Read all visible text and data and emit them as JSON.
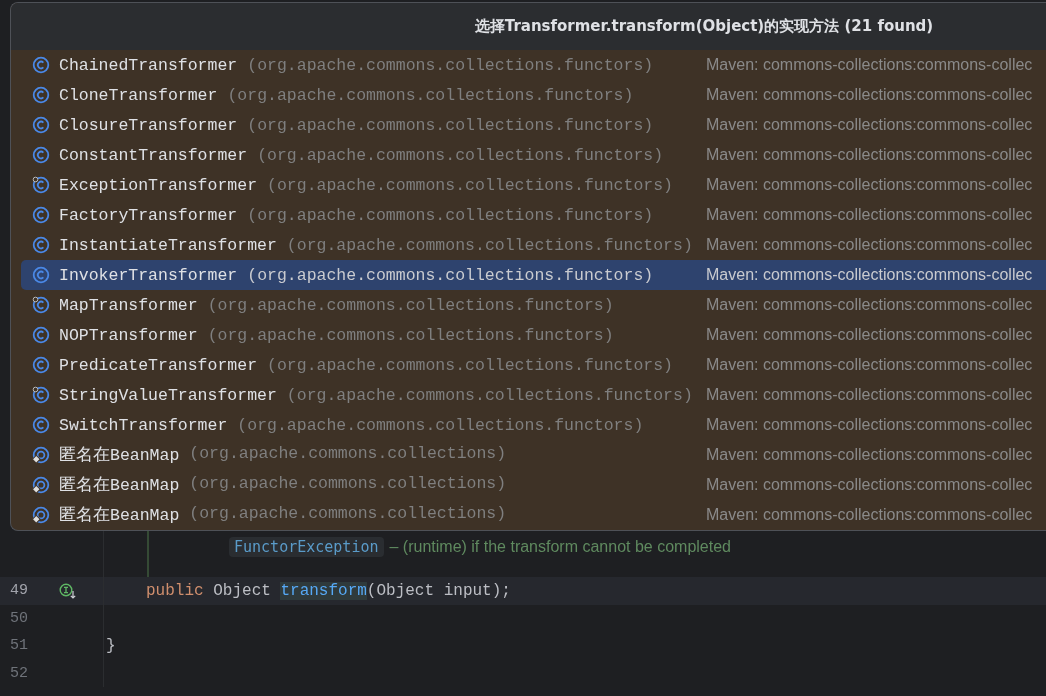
{
  "popup": {
    "title": "选择Transformer.transform(Object)的实现方法 (21 found)",
    "items": [
      {
        "kind": "class",
        "name": "ChainedTransformer",
        "package": "(org.apache.commons.collections.functors)",
        "source": "Maven: commons-collections:commons-collec",
        "selected": false
      },
      {
        "kind": "class",
        "name": "CloneTransformer",
        "package": "(org.apache.commons.collections.functors)",
        "source": "Maven: commons-collections:commons-collec",
        "selected": false
      },
      {
        "kind": "class",
        "name": "ClosureTransformer",
        "package": "(org.apache.commons.collections.functors)",
        "source": "Maven: commons-collections:commons-collec",
        "selected": false
      },
      {
        "kind": "class",
        "name": "ConstantTransformer",
        "package": "(org.apache.commons.collections.functors)",
        "source": "Maven: commons-collections:commons-collec",
        "selected": false
      },
      {
        "kind": "linked-class",
        "name": "ExceptionTransformer",
        "package": "(org.apache.commons.collections.functors)",
        "source": "Maven: commons-collections:commons-collec",
        "selected": false
      },
      {
        "kind": "class",
        "name": "FactoryTransformer",
        "package": "(org.apache.commons.collections.functors)",
        "source": "Maven: commons-collections:commons-collec",
        "selected": false
      },
      {
        "kind": "class",
        "name": "InstantiateTransformer",
        "package": "(org.apache.commons.collections.functors)",
        "source": "Maven: commons-collections:commons-collec",
        "selected": false
      },
      {
        "kind": "class",
        "name": "InvokerTransformer",
        "package": "(org.apache.commons.collections.functors)",
        "source": "Maven: commons-collections:commons-collec",
        "selected": true
      },
      {
        "kind": "linked-class",
        "name": "MapTransformer",
        "package": "(org.apache.commons.collections.functors)",
        "source": "Maven: commons-collections:commons-collec",
        "selected": false
      },
      {
        "kind": "class",
        "name": "NOPTransformer",
        "package": "(org.apache.commons.collections.functors)",
        "source": "Maven: commons-collections:commons-collec",
        "selected": false
      },
      {
        "kind": "class",
        "name": "PredicateTransformer",
        "package": "(org.apache.commons.collections.functors)",
        "source": "Maven: commons-collections:commons-collec",
        "selected": false
      },
      {
        "kind": "linked-class",
        "name": "StringValueTransformer",
        "package": "(org.apache.commons.collections.functors)",
        "source": "Maven: commons-collections:commons-collec",
        "selected": false
      },
      {
        "kind": "class",
        "name": "SwitchTransformer",
        "package": "(org.apache.commons.collections.functors)",
        "source": "Maven: commons-collections:commons-collec",
        "selected": false
      },
      {
        "kind": "anonymous",
        "name": "匿名在BeanMap",
        "package": "(org.apache.commons.collections)",
        "source": "Maven: commons-collections:commons-collec",
        "selected": false
      },
      {
        "kind": "anonymous",
        "name": "匿名在BeanMap",
        "package": "(org.apache.commons.collections)",
        "source": "Maven: commons-collections:commons-collec",
        "selected": false
      },
      {
        "kind": "anonymous",
        "name": "匿名在BeanMap",
        "package": "(org.apache.commons.collections)",
        "source": "Maven: commons-collections:commons-collec",
        "selected": false
      }
    ]
  },
  "editor": {
    "doc": {
      "exception": "FunctorException",
      "text": "– (runtime) if the transform cannot be completed"
    },
    "lines": [
      {
        "number": "49",
        "marker": true,
        "current": true,
        "tokens": [
          {
            "kind": "keyword",
            "text": "public "
          },
          {
            "kind": "plain",
            "text": "Object "
          },
          {
            "kind": "method",
            "text": "transform"
          },
          {
            "kind": "plain",
            "text": "(Object input);"
          }
        ]
      },
      {
        "number": "50",
        "marker": false,
        "current": false
      },
      {
        "number": "51",
        "marker": false,
        "current": false,
        "tokens": [
          {
            "kind": "brace",
            "text": "}"
          }
        ]
      },
      {
        "number": "52",
        "marker": false,
        "current": false
      }
    ]
  }
}
